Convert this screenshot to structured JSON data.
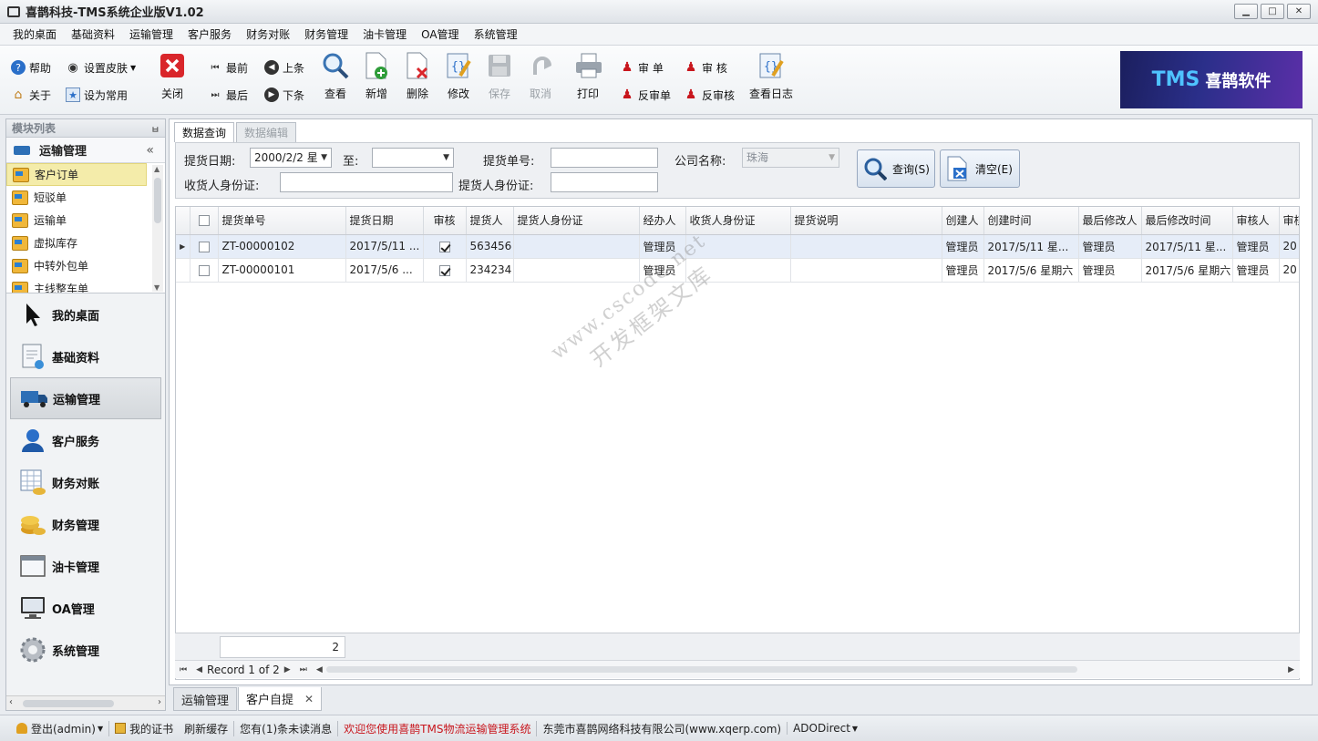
{
  "window": {
    "title": "喜鹊科技-TMS系统企业版V1.02",
    "min": "▁",
    "max": "□",
    "close": "✕"
  },
  "menu": [
    "我的桌面",
    "基础资料",
    "运输管理",
    "客户服务",
    "财务对账",
    "财务管理",
    "油卡管理",
    "OA管理",
    "系统管理"
  ],
  "toolbar": {
    "help": "帮助",
    "skin": "设置皮肤",
    "about": "关于",
    "favorite": "设为常用",
    "close": "关闭",
    "first": "最前",
    "last": "最后",
    "prev": "上条",
    "next": "下条",
    "view": "查看",
    "add": "新增",
    "delete": "删除",
    "edit": "修改",
    "save": "保存",
    "cancel": "取消",
    "print": "打印",
    "approve_doc": "审 单",
    "approve": "审 核",
    "unapprove_doc": "反审单",
    "unapprove": "反审核",
    "log": "查看日志"
  },
  "logo": {
    "tms": "TMS",
    "brand": "喜鹊软件"
  },
  "sidebar": {
    "header": "模块列表",
    "group": "运输管理",
    "sub_items": [
      "客户订单",
      "短驳单",
      "运输单",
      "虚拟库存",
      "中转外包单",
      "主线整车单"
    ],
    "nav": [
      "我的桌面",
      "基础资料",
      "运输管理",
      "客户服务",
      "财务对账",
      "财务管理",
      "油卡管理",
      "OA管理",
      "系统管理"
    ]
  },
  "tabs": [
    "数据查询",
    "数据编辑"
  ],
  "filter": {
    "date_label": "提货日期:",
    "date_value": "2000/2/2 星",
    "to_label": "至:",
    "to_value": "",
    "order_no_label": "提货单号:",
    "order_no_value": "",
    "company_label": "公司名称:",
    "company_value": "珠海",
    "receiver_id_label": "收货人身份证:",
    "receiver_id_value": "",
    "picker_id_label": "提货人身份证:",
    "picker_id_value": "",
    "query_btn": "查询(S)",
    "clear_btn": "清空(E)"
  },
  "grid": {
    "columns": [
      "提货单号",
      "提货日期",
      "审核",
      "提货人",
      "提货人身份证",
      "经办人",
      "收货人身份证",
      "提货说明",
      "创建人",
      "创建时间",
      "最后修改人",
      "最后修改时间",
      "审核人",
      "审核"
    ],
    "rows": [
      {
        "no": "ZT-00000102",
        "date": "2017/5/11 ...",
        "approved": true,
        "picker": "563456",
        "picker_id": "",
        "handler": "管理员",
        "receiver_id": "",
        "note": "",
        "creator": "管理员",
        "created": "2017/5/11 星...",
        "modifier": "管理员",
        "modified": "2017/5/11 星...",
        "approver": "管理员",
        "approve_time": "20"
      },
      {
        "no": "ZT-00000101",
        "date": "2017/5/6 ...",
        "approved": true,
        "picker": "234234",
        "picker_id": "",
        "handler": "管理员",
        "receiver_id": "",
        "note": "",
        "creator": "管理员",
        "created": "2017/5/6 星期六",
        "modifier": "管理员",
        "modified": "2017/5/6 星期六",
        "approver": "管理员",
        "approve_time": "20"
      }
    ],
    "count": "2",
    "record_text": "Record 1 of 2"
  },
  "bottom_tabs": [
    "运输管理",
    "客户自提"
  ],
  "status": {
    "logout": "登出(admin)",
    "cert": "我的证书",
    "refresh": "刷新缓存",
    "messages": "您有(1)条未读消息",
    "welcome": "欢迎您使用喜鹊TMS物流运输管理系统",
    "company": "东莞市喜鹊网络科技有限公司(www.xqerp.com)",
    "db": "ADODirect"
  },
  "watermark": {
    "line1": "www.cscode.net",
    "line2": "开发框架文库"
  }
}
